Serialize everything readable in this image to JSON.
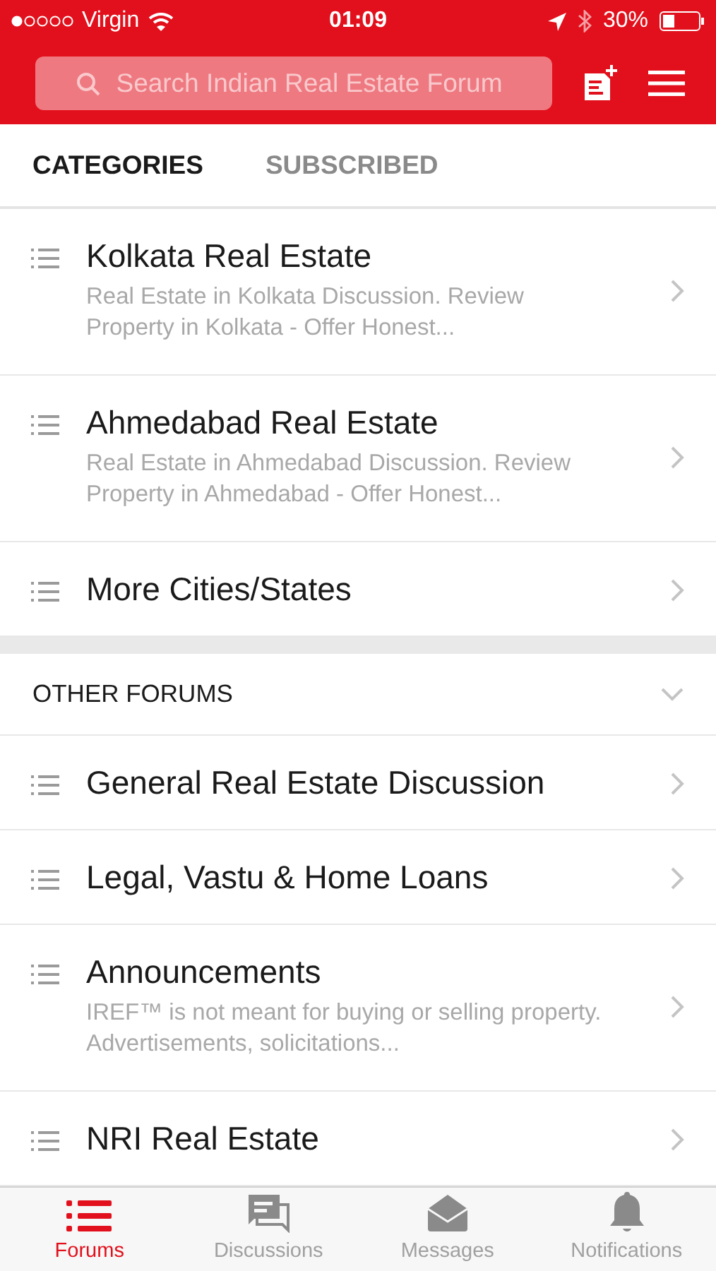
{
  "status_bar": {
    "carrier": "Virgin",
    "time": "01:09",
    "battery": "30%"
  },
  "search": {
    "placeholder": "Search Indian Real Estate Forum"
  },
  "tabs": [
    {
      "label": "CATEGORIES",
      "selected": true
    },
    {
      "label": "SUBSCRIBED",
      "selected": false
    }
  ],
  "categories": [
    {
      "title": "Kolkata Real Estate",
      "description": "Real Estate in Kolkata Discussion. Review Property in Kolkata - Offer Honest..."
    },
    {
      "title": "Ahmedabad Real Estate",
      "description": "Real Estate in Ahmedabad Discussion. Review Property in Ahmedabad - Offer Honest..."
    },
    {
      "title": "More Cities/States"
    }
  ],
  "other_forums": {
    "title": "OTHER FORUMS",
    "expanded": true,
    "items": [
      {
        "title": "General Real Estate Discussion"
      },
      {
        "title": "Legal, Vastu & Home Loans"
      },
      {
        "title": "Announcements",
        "description": "IREF™ is not meant for buying or selling property. Advertisements, solicitations..."
      },
      {
        "title": "NRI Real Estate"
      }
    ]
  },
  "bottom_tabs": [
    {
      "label": "Forums",
      "kind": "forums",
      "selected": true
    },
    {
      "label": "Discussions",
      "kind": "discussions",
      "selected": false
    },
    {
      "label": "Messages",
      "kind": "messages",
      "selected": false
    },
    {
      "label": "Notifications",
      "kind": "notifications",
      "selected": false
    }
  ]
}
